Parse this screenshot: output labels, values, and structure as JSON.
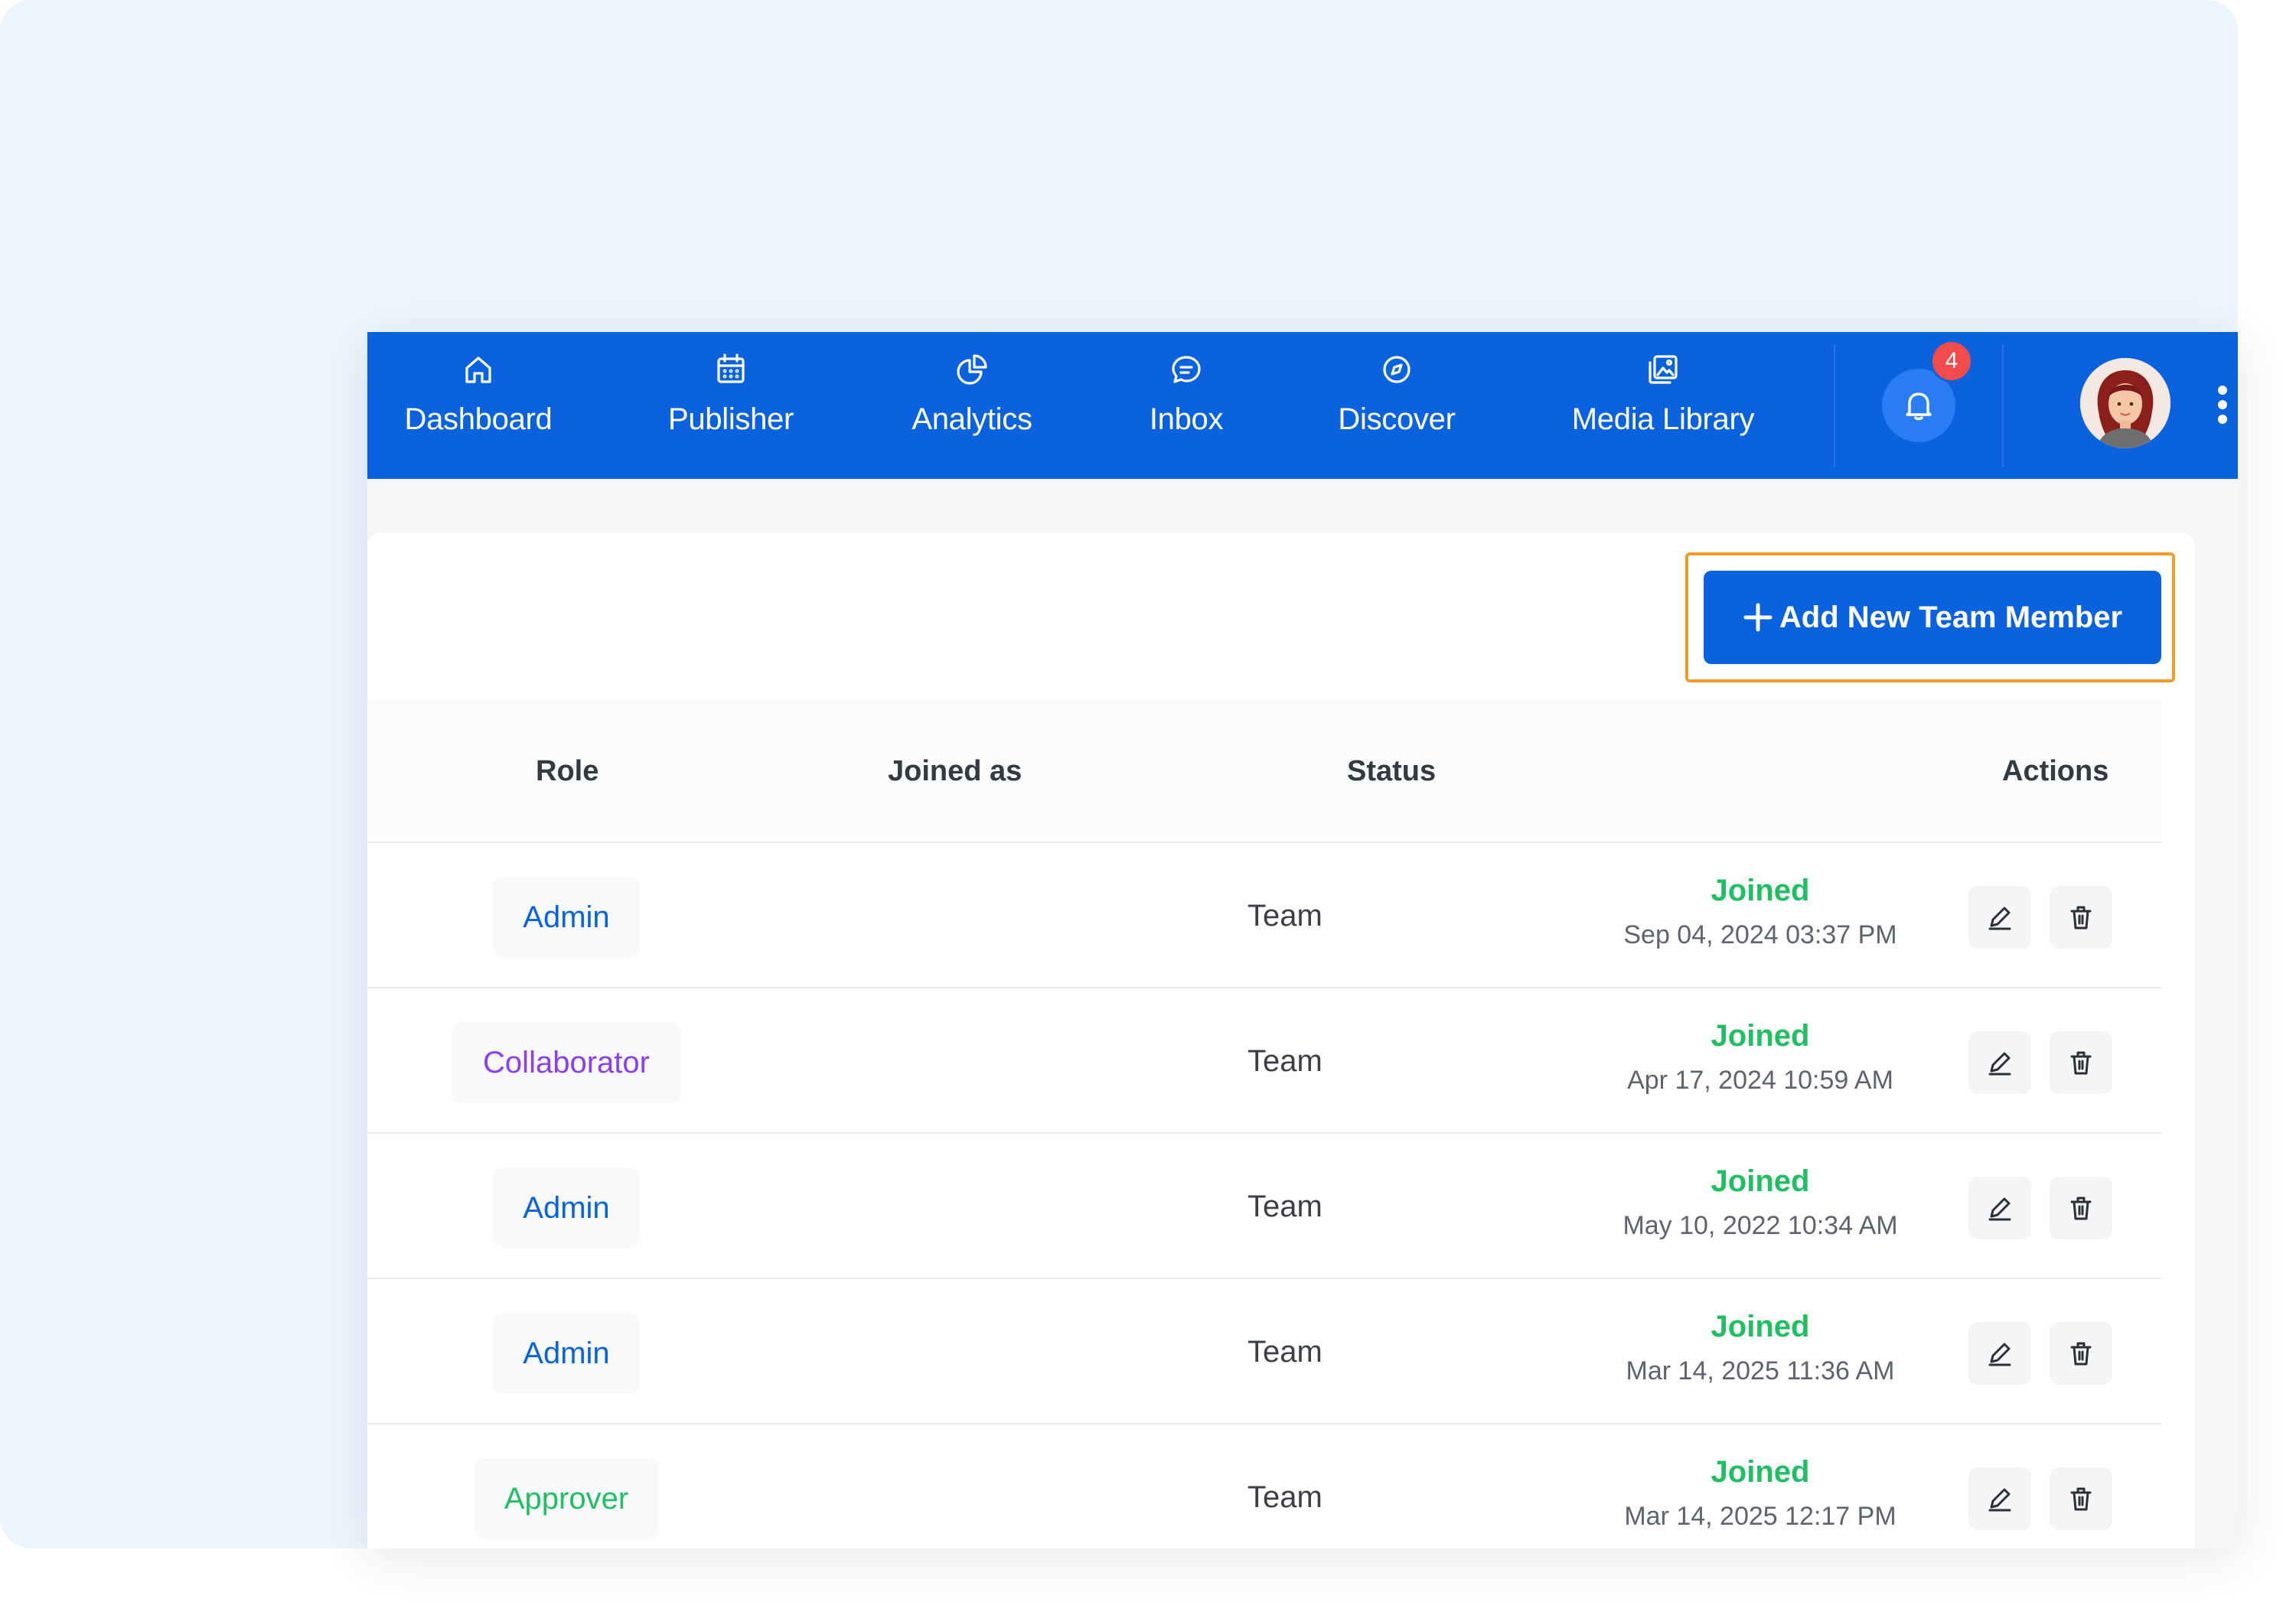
{
  "nav": {
    "items": [
      {
        "label": "Dashboard",
        "icon": "home-icon"
      },
      {
        "label": "Publisher",
        "icon": "calendar-icon"
      },
      {
        "label": "Analytics",
        "icon": "pie-chart-icon"
      },
      {
        "label": "Inbox",
        "icon": "chat-icon"
      },
      {
        "label": "Discover",
        "icon": "compass-icon"
      },
      {
        "label": "Media Library",
        "icon": "image-gallery-icon"
      }
    ],
    "notifications_count": "4"
  },
  "toolbar": {
    "add_label": "Add New Team Member"
  },
  "table": {
    "headers": {
      "role": "Role",
      "joined_as": "Joined as",
      "status": "Status",
      "actions": "Actions"
    },
    "rows": [
      {
        "role": "Admin",
        "joined_as": "Team",
        "status": "Joined",
        "date": "Sep 04, 2024 03:37 PM"
      },
      {
        "role": "Collaborator",
        "joined_as": "Team",
        "status": "Joined",
        "date": "Apr 17, 2024 10:59 AM"
      },
      {
        "role": "Admin",
        "joined_as": "Team",
        "status": "Joined",
        "date": "May 10, 2022 10:34 AM"
      },
      {
        "role": "Admin",
        "joined_as": "Team",
        "status": "Joined",
        "date": "Mar 14, 2025 11:36 AM"
      },
      {
        "role": "Approver",
        "joined_as": "Team",
        "status": "Joined",
        "date": "Mar 14, 2025 12:17 PM"
      }
    ]
  },
  "colors": {
    "nav_bg": "#0b62de",
    "role_admin": "#0b62de",
    "role_collaborator": "#8a3ff0",
    "role_approver": "#1fbf62",
    "status_joined": "#1fbf62",
    "highlight_outline": "#f39c2a",
    "badge": "#f14b4b"
  }
}
